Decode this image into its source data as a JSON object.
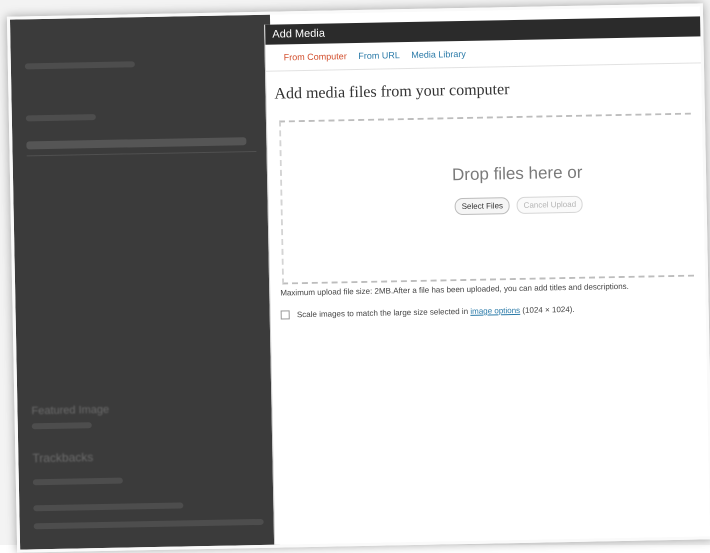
{
  "modal": {
    "title": "Add Media",
    "tabs": [
      "From Computer",
      "From URL",
      "Media Library"
    ],
    "heading": "Add media files from your computer",
    "drop_text": "Drop files here or",
    "select_button": "Select Files",
    "cancel_button": "Cancel Upload",
    "max_size_note": "Maximum upload file size: 2MB.After a file has been uploaded, you can add titles and descriptions.",
    "scale_prefix": "Scale images to match the large size selected in",
    "scale_link": "image options",
    "scale_suffix": "(1024 × 1024)."
  },
  "backdrop": {
    "labels": [
      "Featured Image",
      "Trackbacks"
    ]
  }
}
